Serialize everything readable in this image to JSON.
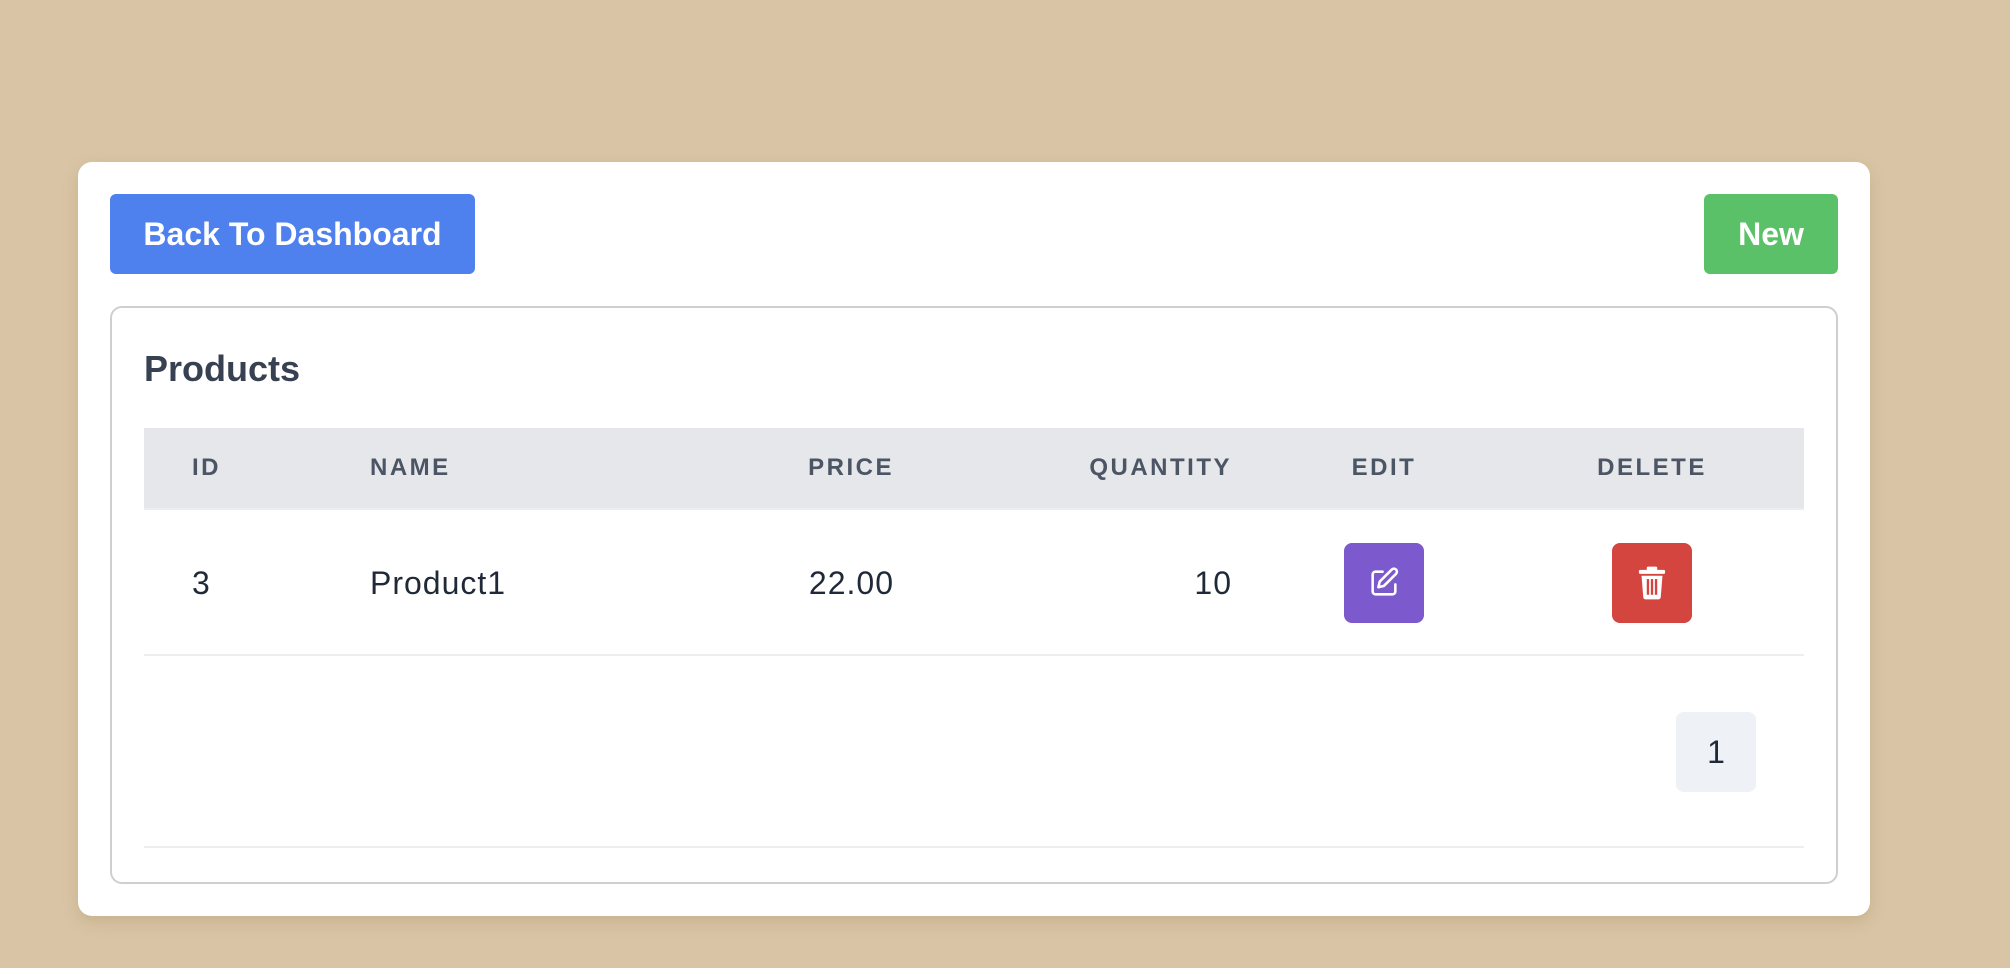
{
  "toolbar": {
    "back_label": "Back To Dashboard",
    "new_label": "New"
  },
  "panel": {
    "title": "Products"
  },
  "table": {
    "columns": [
      "ID",
      "NAME",
      "PRICE",
      "QUANTITY",
      "EDIT",
      "DELETE"
    ],
    "rows": [
      {
        "id": "3",
        "name": "Product1",
        "price": "22.00",
        "quantity": "10"
      }
    ]
  },
  "pagination": {
    "current_page": "1"
  },
  "colors": {
    "background": "#d9c5a5",
    "back_button": "#4e80ee",
    "new_button": "#5bc168",
    "edit_button": "#7c59cc",
    "delete_button": "#d4453f"
  },
  "icons": {
    "edit": "edit-icon",
    "delete": "trash-icon"
  }
}
